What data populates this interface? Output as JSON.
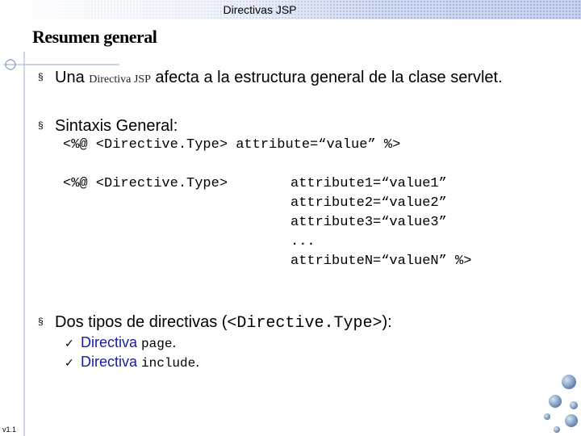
{
  "header": {
    "title": "Directivas JSP"
  },
  "page_title": "Resumen general",
  "bullets": {
    "b1": {
      "marker": "§",
      "text_before": "Una ",
      "emphasis": "Directiva JSP",
      "text_after": " afecta a la estructura general de la clase servlet."
    },
    "b2": {
      "marker": "§",
      "text": "Sintaxis General:"
    },
    "b3": {
      "marker": "§",
      "text_before": "Dos tipos de directivas (",
      "code": "<Directive.Type>",
      "text_after": "):"
    }
  },
  "syntax": {
    "line1": "<%@ <Directive.Type> attribute=“value” %>",
    "line2_left": "<%@ <Directive.Type>",
    "attributes": [
      "attribute1=“value1”",
      "attribute2=“value2”",
      "attribute3=“value3”",
      "...",
      "attributeN=“valueN” %>"
    ]
  },
  "directive_types": {
    "check_mark": "ü",
    "items": [
      {
        "label": "Directiva ",
        "code": "page",
        "suffix": "."
      },
      {
        "label": "Directiva ",
        "code": "include",
        "suffix": "."
      }
    ]
  },
  "footer": {
    "version": "v1.1"
  },
  "colors": {
    "header_band": "#c7d2ee",
    "deco_line": "#a9bbd2",
    "deco_circle": "#7f9bc0",
    "check_label": "#1a1a9c",
    "orb_base": "#7fa0c4",
    "orb_light": "#d7e4f2"
  }
}
